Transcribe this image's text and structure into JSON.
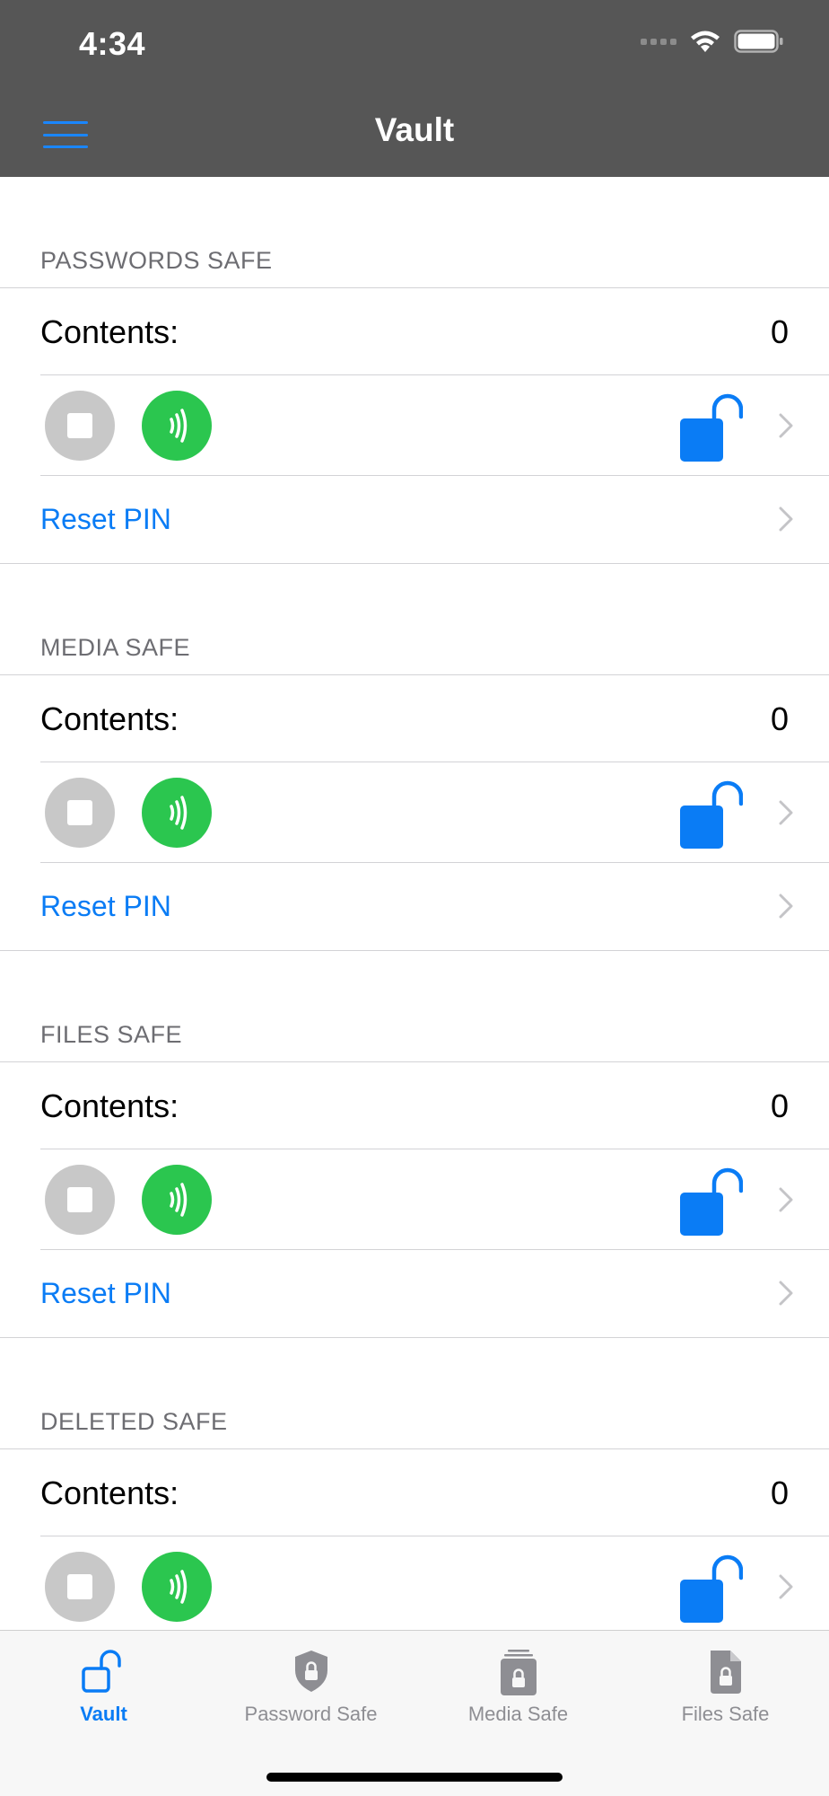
{
  "status_bar": {
    "time": "4:34"
  },
  "nav": {
    "title": "Vault"
  },
  "sections": [
    {
      "header": "PASSWORDS SAFE",
      "contents_label": "Contents:",
      "contents_value": "0",
      "reset_label": "Reset PIN"
    },
    {
      "header": "MEDIA SAFE",
      "contents_label": "Contents:",
      "contents_value": "0",
      "reset_label": "Reset PIN"
    },
    {
      "header": "FILES SAFE",
      "contents_label": "Contents:",
      "contents_value": "0",
      "reset_label": "Reset PIN"
    },
    {
      "header": "DELETED SAFE",
      "contents_label": "Contents:",
      "contents_value": "0"
    }
  ],
  "tabs": [
    {
      "label": "Vault",
      "icon": "unlock-icon",
      "active": true
    },
    {
      "label": "Password Safe",
      "icon": "shield-lock-icon",
      "active": false
    },
    {
      "label": "Media Safe",
      "icon": "photo-stack-lock-icon",
      "active": false
    },
    {
      "label": "Files Safe",
      "icon": "document-lock-icon",
      "active": false
    }
  ],
  "colors": {
    "header_bg": "#565656",
    "accent_blue": "#0a7cf5",
    "nfc_green": "#2bc64f",
    "stop_gray": "#c8c8c8",
    "tab_inactive": "#8e8e93"
  }
}
